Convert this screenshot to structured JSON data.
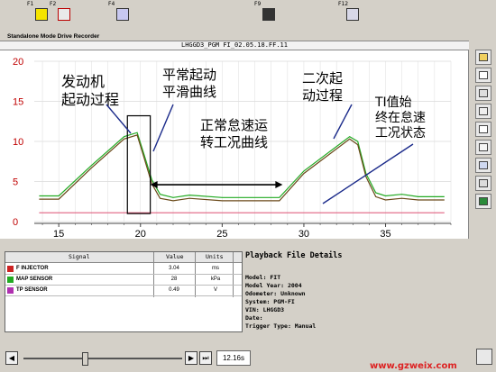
{
  "toolbar": {
    "keys": [
      {
        "label": "F1",
        "icon": "help-icon"
      },
      {
        "label": "F2",
        "icon": "car-icon"
      },
      {
        "label": "F4",
        "icon": "tools-icon"
      },
      {
        "label": "F9",
        "icon": "record-icon"
      },
      {
        "label": "F12",
        "icon": "printer-icon"
      }
    ],
    "mode_text": "Standalone Mode  Drive Recorder"
  },
  "chart_header": "LHGGD3_PGM FI_02.05.18.FF.11",
  "chart_data": {
    "type": "line",
    "x_ticks": [
      "15",
      "20",
      "25",
      "30",
      "35"
    ],
    "y_ticks": [
      "20",
      "15",
      "10",
      "5",
      "0"
    ],
    "xlim": [
      13.5,
      39
    ],
    "ylim": [
      0,
      20
    ],
    "grid": true,
    "series": [
      {
        "name": "F INJECTOR",
        "color": "#22aa22",
        "x": [
          13.8,
          15,
          17,
          19,
          19.8,
          20.2,
          20.7,
          21.2,
          22,
          23,
          25,
          27,
          28.5,
          30,
          32.8,
          33.3,
          33.8,
          34.4,
          35,
          36,
          37,
          38.6
        ],
        "y": [
          3.2,
          3.2,
          7.0,
          10.6,
          11.1,
          8.5,
          5.2,
          3.4,
          3.0,
          3.3,
          3.0,
          3.0,
          3.0,
          6.3,
          10.6,
          10.0,
          6.0,
          3.6,
          3.2,
          3.4,
          3.1,
          3.1
        ]
      },
      {
        "name": "MAP SENSOR",
        "color": "#6b4a1a",
        "x": [
          13.8,
          15,
          17,
          19,
          19.8,
          20.2,
          20.7,
          21.2,
          22,
          23,
          25,
          27,
          28.5,
          30,
          32.8,
          33.3,
          33.8,
          34.4,
          35,
          36,
          37,
          38.6
        ],
        "y": [
          2.8,
          2.8,
          6.7,
          10.3,
          10.8,
          8.1,
          4.7,
          2.9,
          2.6,
          2.9,
          2.6,
          2.6,
          2.6,
          6.0,
          10.3,
          9.6,
          5.6,
          3.1,
          2.7,
          2.9,
          2.7,
          2.7
        ]
      },
      {
        "name": "TP SENSOR",
        "color": "#e06080",
        "x": [
          13.8,
          38.6
        ],
        "y": [
          1.1,
          1.1
        ]
      }
    ],
    "annotations": [
      {
        "text_lines": [
          "发动机",
          "起动过程"
        ]
      },
      {
        "text_lines": [
          "平常起动",
          "平滑曲线"
        ]
      },
      {
        "text_lines": [
          "正常怠速运",
          "转工况曲线"
        ]
      },
      {
        "text_lines": [
          "二次起",
          "动过程"
        ]
      },
      {
        "text_lines": [
          "TI值始",
          "终在怠速",
          "工况状态"
        ]
      }
    ]
  },
  "sensor_table": {
    "headers": {
      "signal": "Signal",
      "value": "Value",
      "units": "Units"
    },
    "rows": [
      {
        "signal": "F INJECTOR",
        "value": "3.04",
        "units": "ms",
        "color": "#cc2222"
      },
      {
        "signal": "MAP SENSOR",
        "value": "28",
        "units": "kPa",
        "color": "#22aa22"
      },
      {
        "signal": "TP SENSOR",
        "value": "0.49",
        "units": "V",
        "color": "#b030b0"
      }
    ]
  },
  "details": {
    "title": "Playback File Details",
    "lines": [
      "Model: FIT",
      "Model Year: 2004",
      "Odometer: Unknown",
      "System: PGM-FI",
      "VIN: LHGGD3",
      "Date:",
      "Trigger Type: Manual"
    ]
  },
  "playback": {
    "time": "12.16s",
    "position": 0.38
  },
  "watermark": "www.gzweix.com"
}
